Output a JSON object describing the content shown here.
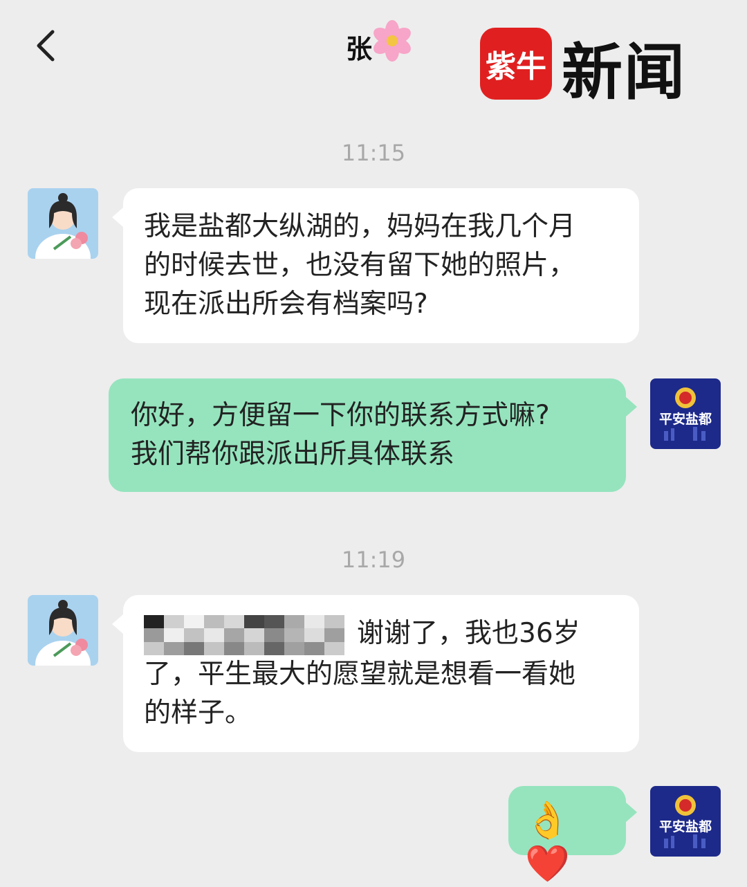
{
  "header": {
    "contact_name": "张",
    "watermark_logo": "紫牛",
    "watermark_text": "新闻"
  },
  "messages": [
    {
      "type": "time",
      "text": "11:15"
    },
    {
      "type": "in",
      "lines": [
        "我是盐都大纵湖的，妈妈在我几个月",
        "的时候去世，也没有留下她的照片，",
        "现在派出所会有档案吗?"
      ]
    },
    {
      "type": "out",
      "lines": [
        "你好，方便留一下你的联系方式嘛?",
        "我们帮你跟派出所具体联系"
      ]
    },
    {
      "type": "time",
      "text": "11:19"
    },
    {
      "type": "in",
      "lines": [
        "谢谢了，我也36岁",
        "了，平生最大的愿望就是想看一看她",
        "的样子。"
      ]
    },
    {
      "type": "out",
      "emoji": "👌❤️"
    }
  ],
  "police_avatar_text": "平安盐都",
  "colors": {
    "background": "#ededed",
    "outgoing_bubble": "#95e4be",
    "incoming_bubble": "#ffffff",
    "brand_red": "#e02020"
  }
}
